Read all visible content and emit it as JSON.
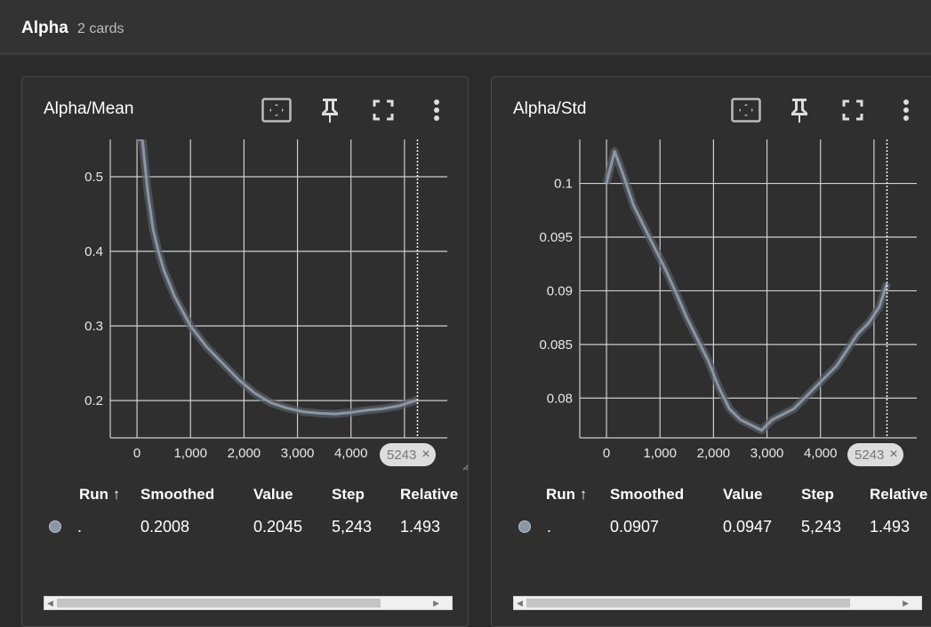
{
  "group": {
    "title": "Alpha",
    "count_label": "2 cards"
  },
  "colors": {
    "series": "#8a96a3",
    "series_raw": "#5a6068",
    "grid": "#cfcfcf",
    "background": "#2f2f2f"
  },
  "icons": [
    "fit-domain-icon",
    "pin-icon",
    "fullscreen-icon",
    "more-vert-icon"
  ],
  "table_headers": {
    "run": "Run ↑",
    "smoothed": "Smoothed",
    "value": "Value",
    "step": "Step",
    "relative": "Relative"
  },
  "cards": [
    {
      "title": "Alpha/Mean",
      "step_badge": "5243",
      "step_badge_close": "×",
      "row": {
        "run": ".",
        "smoothed": "0.2008",
        "value": "0.2045",
        "step": "5,243",
        "relative": "1.493"
      },
      "chart_data": {
        "type": "line",
        "x_ticks": [
          "0",
          "1,000",
          "2,000",
          "3,000",
          "4,000"
        ],
        "y_ticks": [
          "0.2",
          "0.3",
          "0.4",
          "0.5"
        ],
        "xlim": [
          -500,
          5800
        ],
        "ylim": [
          0.15,
          0.55
        ],
        "marker_step": 5243,
        "series": [
          {
            "x": [
              0,
              100,
              200,
              300,
              400,
              500,
              700,
              1000,
              1300,
              1600,
              1900,
              2200,
              2500,
              2800,
              3100,
              3400,
              3700,
              4000,
              4300,
              4600,
              4900,
              5243
            ],
            "y": [
              0.55,
              0.55,
              0.48,
              0.43,
              0.4,
              0.375,
              0.34,
              0.3,
              0.272,
              0.25,
              0.228,
              0.21,
              0.197,
              0.19,
              0.185,
              0.183,
              0.182,
              0.184,
              0.187,
              0.189,
              0.193,
              0.2008
            ]
          }
        ]
      }
    },
    {
      "title": "Alpha/Std",
      "step_badge": "5243",
      "step_badge_close": "×",
      "row": {
        "run": ".",
        "smoothed": "0.0907",
        "value": "0.0947",
        "step": "5,243",
        "relative": "1.493"
      },
      "chart_data": {
        "type": "line",
        "x_ticks": [
          "0",
          "1,000",
          "2,000",
          "3,000",
          "4,000"
        ],
        "y_ticks": [
          "0.08",
          "0.085",
          "0.09",
          "0.095",
          "0.1"
        ],
        "xlim": [
          -500,
          5800
        ],
        "ylim": [
          0.0763,
          0.1041
        ],
        "marker_step": 5243,
        "series": [
          {
            "x": [
              0,
              150,
              300,
              500,
              700,
              900,
              1100,
              1300,
              1500,
              1700,
              1900,
              2100,
              2300,
              2500,
              2700,
              2900,
              3100,
              3300,
              3500,
              3700,
              3900,
              4100,
              4300,
              4500,
              4700,
              4900,
              5100,
              5243
            ],
            "y": [
              0.1,
              0.103,
              0.101,
              0.098,
              0.096,
              0.094,
              0.092,
              0.0898,
              0.0875,
              0.0855,
              0.0835,
              0.081,
              0.079,
              0.078,
              0.0775,
              0.077,
              0.078,
              0.0785,
              0.079,
              0.08,
              0.081,
              0.082,
              0.083,
              0.0845,
              0.086,
              0.087,
              0.0885,
              0.0907
            ]
          }
        ]
      }
    }
  ]
}
